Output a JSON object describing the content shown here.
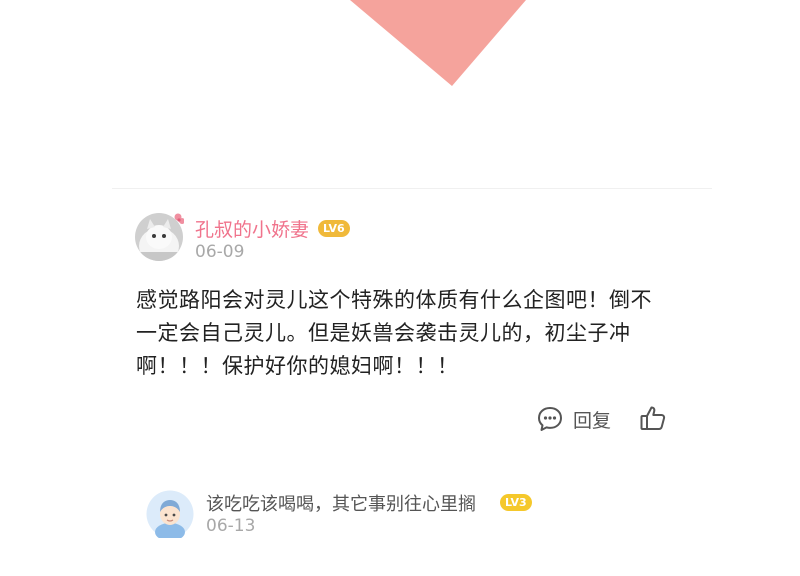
{
  "colors": {
    "accent_triangle": "#f5a39c",
    "username_pink": "#f0738c",
    "badge_orange": "#f0b93a",
    "badge_yellow": "#f5c82b"
  },
  "comments": [
    {
      "username": "孔叔的小娇妻",
      "level": "LV6",
      "date": "06-09",
      "text_lines": [
        "感觉路阳会对灵儿这个特殊的体质有什么企图吧！倒不",
        "一定会自己灵儿。但是妖兽会袭击灵儿的，初尘子冲",
        "啊！！！保护好你的媳妇啊！！！"
      ],
      "reply_icon": "chat-bubble-icon",
      "reply_label": "回复",
      "like_icon": "thumbs-up-icon"
    },
    {
      "username": "该吃吃该喝喝，其它事别往心里搁",
      "level": "LV3",
      "date": "06-13"
    }
  ]
}
